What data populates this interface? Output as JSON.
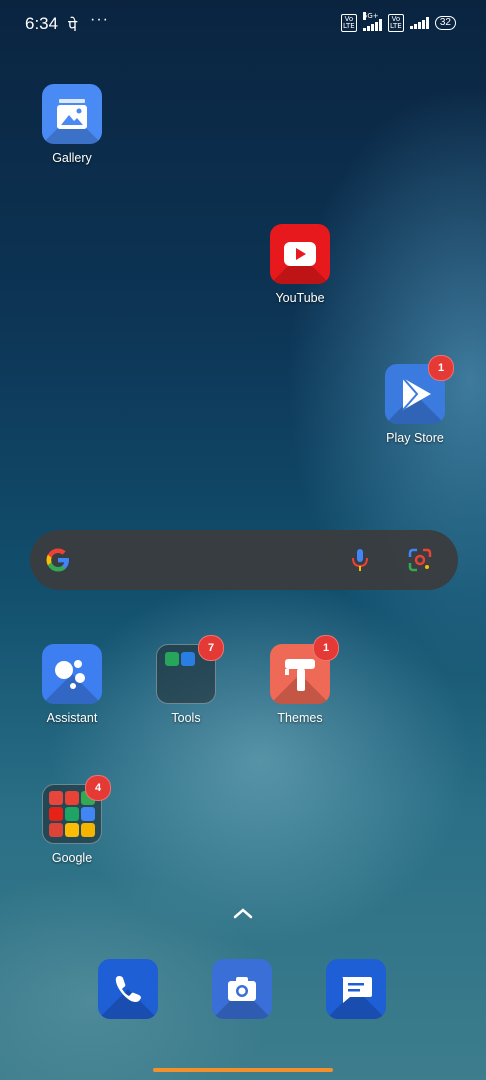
{
  "status_bar": {
    "time": "6:34",
    "extra": "पे",
    "dots": "···",
    "volte1": "Vo LTE",
    "network1": "5G+",
    "volte2": "Vo LTE",
    "battery": "32"
  },
  "apps": {
    "gallery": {
      "label": "Gallery"
    },
    "youtube": {
      "label": "YouTube"
    },
    "playstore": {
      "label": "Play Store",
      "badge": "1"
    },
    "assistant": {
      "label": "Assistant"
    },
    "tools": {
      "label": "Tools",
      "badge": "7"
    },
    "themes": {
      "label": "Themes",
      "badge": "1"
    },
    "google": {
      "label": "Google",
      "badge": "4"
    }
  },
  "search_bar": {
    "logo": "google-g-icon",
    "mic": "mic-icon",
    "lens": "lens-icon"
  },
  "dock": [
    "phone-icon",
    "camera-icon",
    "messages-icon"
  ],
  "colors": {
    "gallery": "#4a8af4",
    "youtube": "#e8191c",
    "playstore": "#3b7be0",
    "assistant": "#3d7ef0",
    "themes": "#ef6a56",
    "badge": "#e53935",
    "dock": "#1f5fd6",
    "handle": "#f4902c"
  }
}
